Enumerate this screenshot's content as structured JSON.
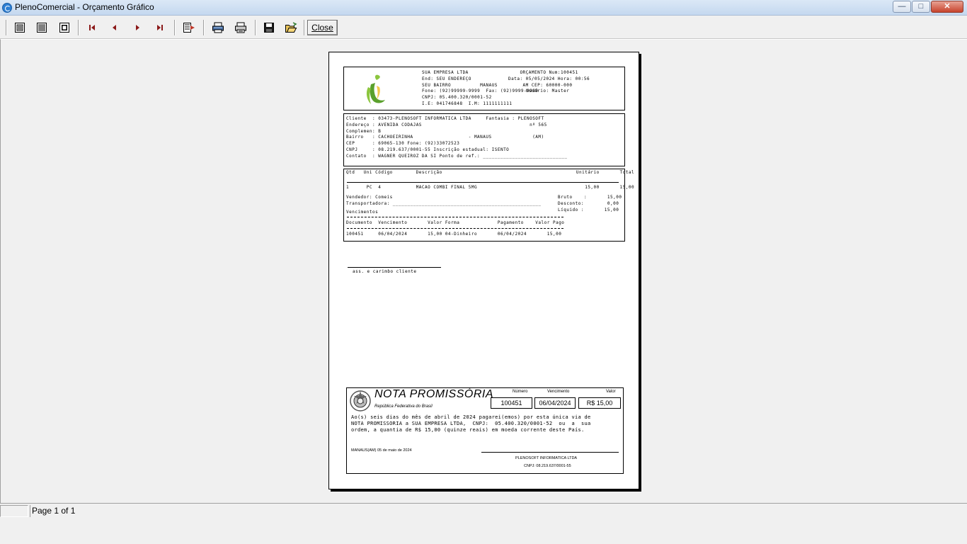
{
  "window": {
    "title": "PlenoComercial - Orçamento Gráfico"
  },
  "toolbar": {
    "close_label": "Close"
  },
  "status": {
    "page_info": "Page 1 of 1"
  },
  "report": {
    "header_left": "SUA EMPRESA LTDA\nEnd: SEU ENDEREÇO\nSEU BAIRRO          MANAUS\nFone: (92)99999-9999  Fax: (92)9999-9999\nCNPJ: 05.400.320/0001-52\nI.E: 041746848  I.M: 1111111111",
    "header_right": "    ORÇAMENTO Num:100451\nData: 05/05/2024 Hora: 00:56\n     AM CEP: 60000-000\n      Usuário: Master",
    "client": "Cliente  : 03473-PLENOSOFT INFORMATICA LTDA     Fantasia : PLENOSOFT\nEndereço : AVENIDA CODAJAS                                     nº 565\nComplemen: B\nBairro   : CACHOEIRINHA                   - MANAUS              (AM)\nCEP      : 69065-130 Fone: (92)33072523\nCNPJ     : 08.219.637/0001-55 Inscrição estadual: ISENTO\nContato  : WAGNER QUEIROZ DA SI Ponto de ref.: _____________________________",
    "items_header": "Qtd   Uni Código        Descrição                                              Unitário       Total",
    "item_row": "1      PC  4            MACAO COMBI FINAL 5MG                                     15,00       15,00",
    "seller": "Vendedor: Comeis\nTransportadora: ___________________________________________________",
    "totals": "Bruto    :       15,00\nDesconto:        0,00\nLíquido :       15,00",
    "due_title": "Vencimentos",
    "due_header": "Documento  Vencimento       Valor Forma             Pagamento    Valor Pago",
    "due_row": "100451     06/04/2024       15,00 04-Dinheiro       06/04/2024       15,00",
    "signature_label": "ass. e carimbo cliente"
  },
  "promissoria": {
    "title": "NOTA PROMISSÓRIA",
    "subtitle": "República Federativa do Brasil",
    "numero_label": "Número",
    "vencimento_label": "Vencimento",
    "valor_label": "Valor",
    "numero": "100451",
    "vencimento": "06/04/2024",
    "valor": "R$ 15,00",
    "text": "Ao(s) seis dias do mês de abril de 2024 pagarei(emos) por esta única via de\nNOTA PROMISSORIA a SUA EMPRESA LTDA,  CNPJ:  05.400.320/0001-52  ou  a  sua\nordem, a quantia de R$ 15,00 (quinze reais) em moeda corrente deste País.",
    "local_data": "MANAUS(AM) 05 de maio de 2024",
    "emitente": "PLENOSOFT INFORMATICA LTDA",
    "cnpj": "CNPJ: 08.219.637/0001-55"
  },
  "icons": [
    "page-width-icon",
    "full-page-icon",
    "zoom-icon",
    "first-page-icon",
    "prev-page-icon",
    "next-page-icon",
    "last-page-icon",
    "export-icon",
    "printer-setup-icon",
    "print-icon",
    "save-icon",
    "open-icon"
  ]
}
